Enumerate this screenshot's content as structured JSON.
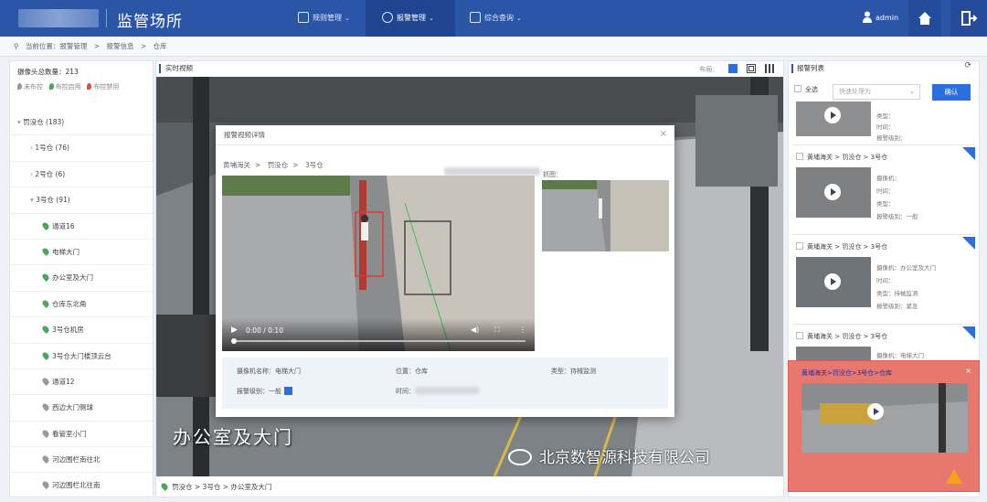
{
  "app": {
    "title": "监管场所"
  },
  "nav": [
    {
      "label": "规则管理",
      "active": false
    },
    {
      "label": "报警管理",
      "active": true
    },
    {
      "label": "综合查询",
      "active": false
    }
  ],
  "user": {
    "name": "admin"
  },
  "breadcrumb": {
    "prefix": "当前位置：报警管理",
    "sep": ">",
    "items": [
      "报警信息",
      "仓库"
    ]
  },
  "left": {
    "camera_count": "摄像头总数量：213",
    "legend": [
      "未布控",
      "布控启用",
      "布控禁用"
    ],
    "tree": [
      {
        "label": "罚没仓 (183)",
        "level": 0
      },
      {
        "label": "1号仓 (76)",
        "level": 1
      },
      {
        "label": "2号仓 (6)",
        "level": 1
      },
      {
        "label": "3号仓 (91)",
        "level": 1
      },
      {
        "label": "通道16",
        "level": 2,
        "status": "green"
      },
      {
        "label": "电梯大门",
        "level": 2,
        "status": "green"
      },
      {
        "label": "办公室及大门",
        "level": 2,
        "status": "green"
      },
      {
        "label": "仓库东北角",
        "level": 2,
        "status": "green"
      },
      {
        "label": "3号仓机房",
        "level": 2,
        "status": "green"
      },
      {
        "label": "3号仓大门楼顶云台",
        "level": 2,
        "status": "green"
      },
      {
        "label": "通道12",
        "level": 2,
        "status": "gray"
      },
      {
        "label": "西边大门侧球",
        "level": 2,
        "status": "gray"
      },
      {
        "label": "看管室小门",
        "level": 2,
        "status": "gray"
      },
      {
        "label": "河边围栏南往北",
        "level": 2,
        "status": "gray"
      },
      {
        "label": "河边围栏北往南",
        "level": 2,
        "status": "gray"
      }
    ]
  },
  "main": {
    "title": "实时视频",
    "layout_label": "布局：",
    "video_caption": "办公室及大门",
    "watermark": "北京数智源科技有限公司",
    "footer_path": "罚没仓 > 3号仓 > 办公室及大门"
  },
  "dialog": {
    "title": "报警视频详情",
    "close": "×",
    "crumb": [
      "黄埔海关",
      "罚没仓",
      "3号仓"
    ],
    "snapshot_label": "抓图：",
    "player_time": "0:00 / 0:10",
    "info": {
      "camera": "摄像机名称：电梯大门",
      "location": "位置：仓库",
      "type": "类型：持械监测",
      "level_label": "报警级别：一般",
      "time_label": "时间："
    }
  },
  "right": {
    "title": "报警列表",
    "select_all": "全选",
    "select_placeholder": "快速处理为",
    "confirm": "确认",
    "cards": [
      {
        "title": "",
        "f1": "类型：",
        "f2": "时间：",
        "f3": "报警级别："
      },
      {
        "title": "黄埔海关 > 罚没仓 > 3号仓",
        "f1": "摄像机：",
        "f2": "时间：",
        "f3": "类型：",
        "f4": "报警级别：一般"
      },
      {
        "title": "黄埔海关 > 罚没仓 > 3号仓",
        "f1": "摄像机：办公室及大门",
        "f2": "时间：",
        "f3": "类型：持械监测",
        "f4": "报警级别：紧急"
      },
      {
        "title": "黄埔海关 > 罚没仓 > 3号仓",
        "f1": "摄像机：电梯大门"
      }
    ],
    "popup_title": "黄埔海关>罚没仓>3号仓>仓库",
    "popup_close": "×"
  },
  "colors": {
    "header": "#2b56a8",
    "accent": "#2b6ee0",
    "alarm": "#e8776e"
  }
}
